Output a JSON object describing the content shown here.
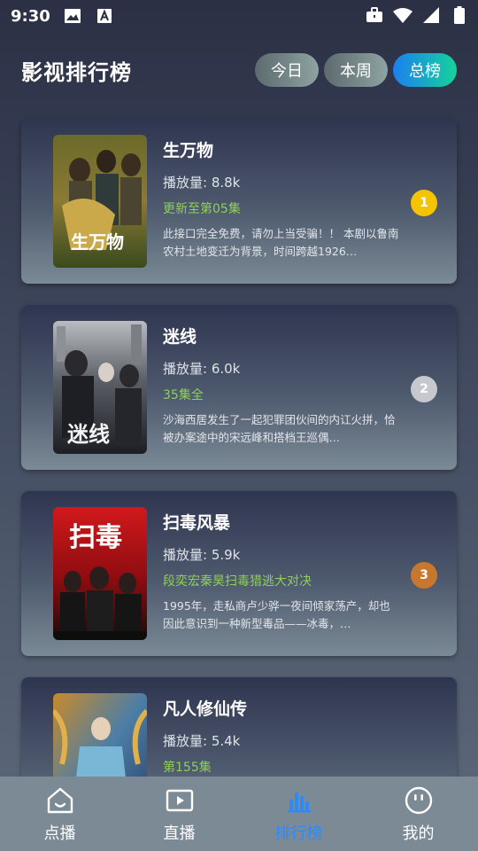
{
  "status_bar": {
    "time": "9:30"
  },
  "header": {
    "title": "影视排行榜",
    "tabs": [
      {
        "label": "今日",
        "active": false
      },
      {
        "label": "本周",
        "active": false
      },
      {
        "label": "总榜",
        "active": true
      }
    ]
  },
  "items": [
    {
      "title": "生万物",
      "plays": "播放量: 8.8k",
      "update": "更新至第05集",
      "desc": "此接口完全免费，请勿上当受骗！！ 本剧以鲁南农村土地变迁为背景，时间跨越1926…",
      "rank": "1",
      "rank_color": "#f5c400"
    },
    {
      "title": "迷线",
      "plays": "播放量: 6.0k",
      "update": "35集全",
      "desc": "沙海西居发生了一起犯罪团伙间的内讧火拼，恰被办案途中的宋远峰和搭档王巡偶…",
      "rank": "2",
      "rank_color": "#c5c8cc"
    },
    {
      "title": "扫毒风暴",
      "plays": "播放量: 5.9k",
      "update": "段奕宏秦昊扫毒猎逃大对决",
      "desc": "1995年，走私商卢少骅一夜间倾家荡产，却也因此意识到一种新型毒品——冰毒，…",
      "rank": "3",
      "rank_color": "#c8782e"
    },
    {
      "title": "凡人修仙传",
      "plays": "播放量: 5.4k",
      "update": "第155集",
      "desc": "",
      "rank": "",
      "rank_color": ""
    }
  ],
  "bottom_nav": [
    {
      "label": "点播",
      "icon": "home-icon",
      "active": false
    },
    {
      "label": "直播",
      "icon": "play-icon",
      "active": false
    },
    {
      "label": "排行榜",
      "icon": "chart-icon",
      "active": true
    },
    {
      "label": "我的",
      "icon": "face-icon",
      "active": false
    }
  ],
  "colors": {
    "accent": "#2f8af5",
    "update_green": "#8fcf5a"
  }
}
